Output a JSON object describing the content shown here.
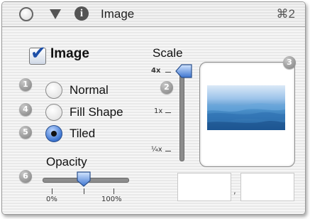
{
  "window": {
    "title": "Image",
    "shortcut": "⌘2"
  },
  "image_toggle": {
    "label": "Image",
    "checked": true
  },
  "fill_mode": {
    "options": [
      {
        "label": "Normal",
        "badge": "1",
        "selected": false
      },
      {
        "label": "Fill Shape",
        "badge": "4",
        "selected": false
      },
      {
        "label": "Tiled",
        "badge": "5",
        "selected": true
      }
    ]
  },
  "opacity": {
    "label": "Opacity",
    "badge": "6",
    "min_label": "0%",
    "max_label": "100%",
    "value_percent": 45
  },
  "scale": {
    "label": "Scale",
    "badge": "2",
    "ticks": [
      "4x",
      "1x",
      "¼x"
    ],
    "value": "4x"
  },
  "preview": {
    "badge": "3"
  },
  "fields": {
    "separator": ","
  },
  "colors": {
    "accent": "#3c74d0",
    "preview_water": "#4a8fc9"
  }
}
